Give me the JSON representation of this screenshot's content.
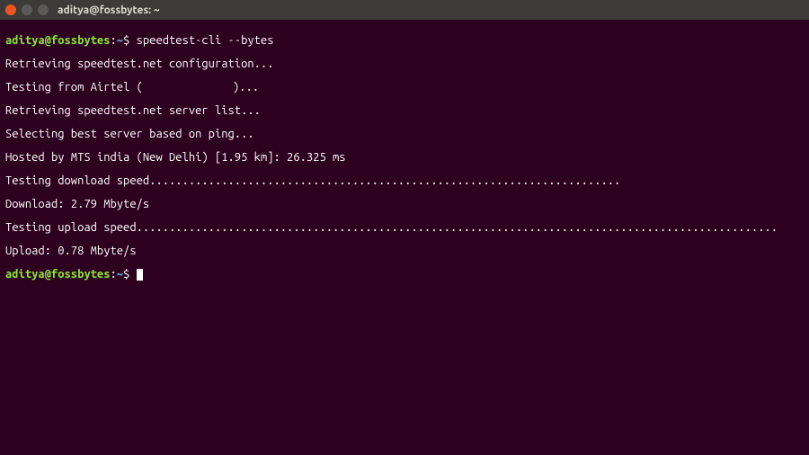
{
  "titlebar": {
    "title": "aditya@fossbytes: ~"
  },
  "prompt": {
    "user_host": "aditya@fossbytes",
    "colon": ":",
    "path": "~",
    "dollar": "$ "
  },
  "command": "speedtest-cli --bytes",
  "output": {
    "l1": "Retrieving speedtest.net configuration...",
    "l2a": "Testing from Airtel (",
    "l2b": ")...",
    "l3": "Retrieving speedtest.net server list...",
    "l4": "Selecting best server based on ping...",
    "l5": "Hosted by MTS india (New Delhi) [1.95 km]: 26.325 ms",
    "l6": "Testing download speed........................................................................",
    "l7": "Download: 2.79 Mbyte/s",
    "l8": "Testing upload speed..................................................................................................",
    "l9": "Upload: 0.78 Mbyte/s"
  }
}
